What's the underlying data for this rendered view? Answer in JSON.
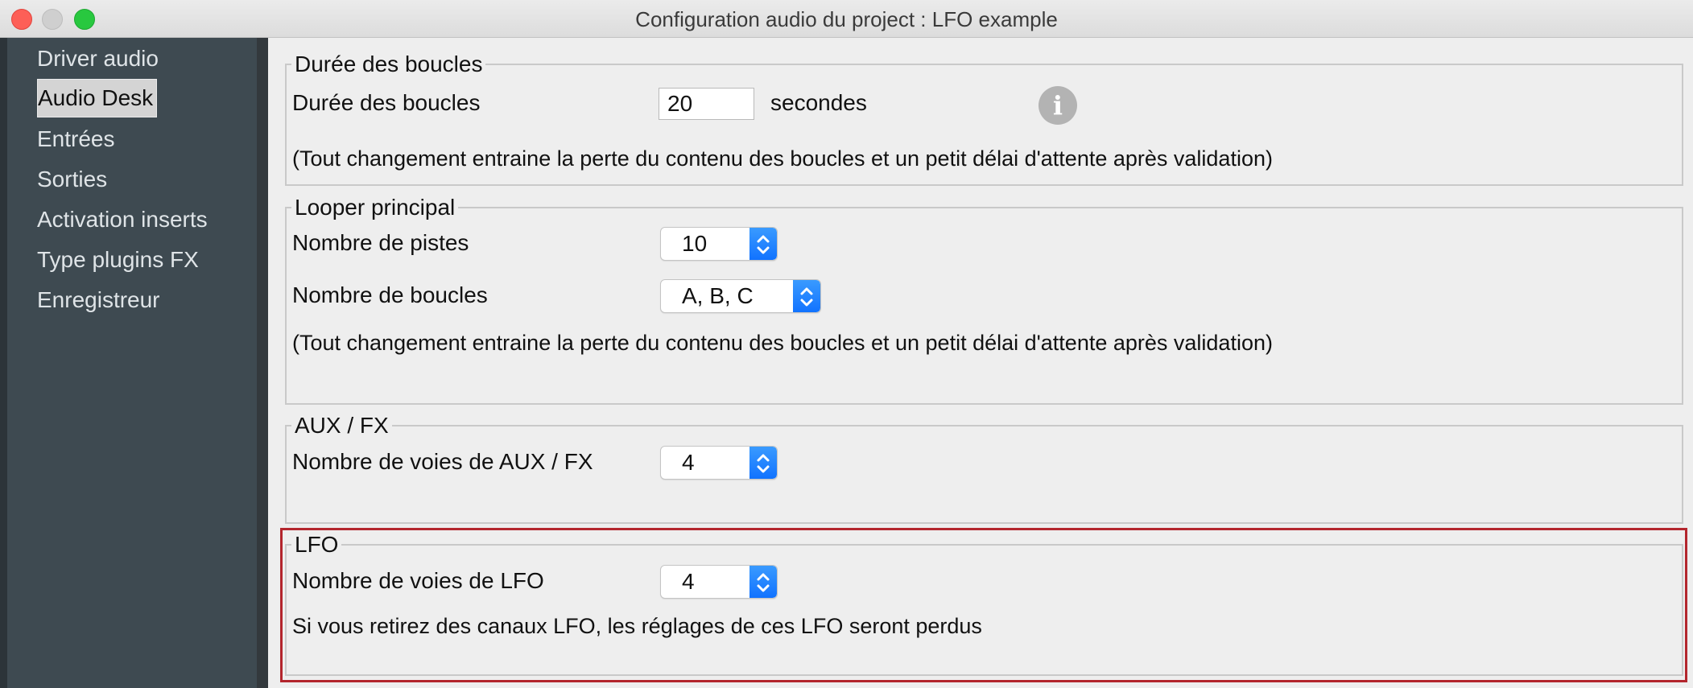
{
  "window": {
    "title": "Configuration audio du project : LFO example"
  },
  "sidebar": {
    "items": [
      {
        "label": "Driver audio"
      },
      {
        "label": "Audio Desk",
        "selected": true
      },
      {
        "label": "Entrées"
      },
      {
        "label": "Sorties"
      },
      {
        "label": "Activation inserts"
      },
      {
        "label": "Type plugins FX"
      },
      {
        "label": "Enregistreur"
      }
    ]
  },
  "loop_duration": {
    "title": "Durée des boucles",
    "label": "Durée des boucles",
    "value": "20",
    "unit": "secondes",
    "note": "(Tout changement entraine la perte du contenu des boucles et un petit délai d'attente après validation)",
    "info_icon": "info-icon"
  },
  "main_looper": {
    "title": "Looper principal",
    "tracks_label": "Nombre de pistes",
    "tracks_value": "10",
    "loops_label": "Nombre de boucles",
    "loops_value": "A, B, C",
    "note": "(Tout changement entraine la perte du contenu des boucles et un petit délai d'attente après validation)"
  },
  "aux_fx": {
    "title": "AUX / FX",
    "channels_label": "Nombre de voies de AUX / FX",
    "channels_value": "4"
  },
  "lfo": {
    "title": "LFO",
    "channels_label": "Nombre de voies de LFO",
    "channels_value": "4",
    "note": "Si vous retirez des canaux LFO, les réglages de ces LFO seront perdus"
  },
  "colors": {
    "sidebar_bg": "#3e4a51",
    "highlight_border": "#b3262d",
    "stepper_blue": "#1173ff"
  }
}
